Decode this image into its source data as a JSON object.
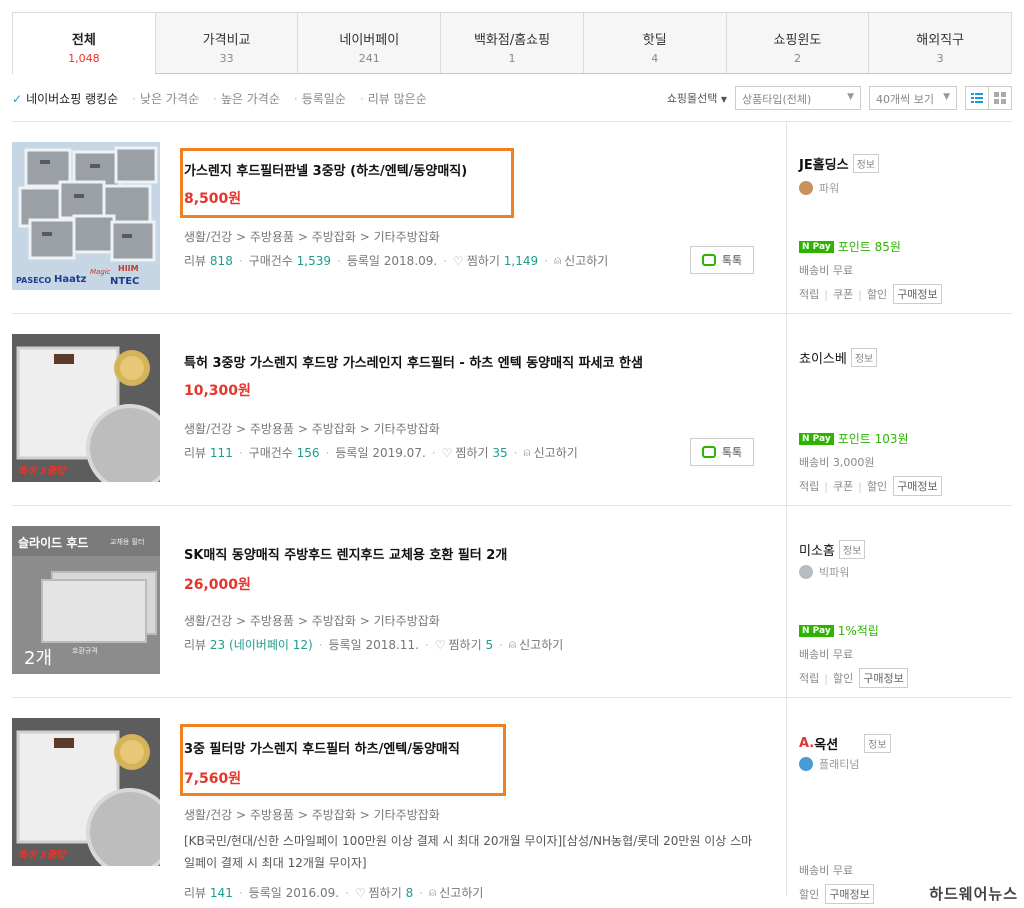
{
  "tabs": [
    {
      "label": "전체",
      "count": "1,048"
    },
    {
      "label": "가격비교",
      "count": "33"
    },
    {
      "label": "네이버페이",
      "count": "241"
    },
    {
      "label": "백화점/홈쇼핑",
      "count": "1"
    },
    {
      "label": "핫딜",
      "count": "4"
    },
    {
      "label": "쇼핑윈도",
      "count": "2"
    },
    {
      "label": "해외직구",
      "count": "3"
    }
  ],
  "sort": {
    "active": "네이버쇼핑 랭킹순",
    "options": [
      "낮은 가격순",
      "높은 가격순",
      "등록일순",
      "리뷰 많은순"
    ]
  },
  "toolbar": {
    "mall_select": "쇼핑몰선택",
    "product_type": "상품타입(전체)",
    "per_page": "40개씩 보기"
  },
  "items": [
    {
      "title": "가스렌지 후드필터판넬 3중망 (하츠/엔텍/동양매직)",
      "price": "8,500원",
      "category": "생활/건강 > 주방용품 > 주방잡화 > 기타주방잡화",
      "review_label": "리뷰",
      "review": "818",
      "purchase_label": "구매건수",
      "purchase": "1,539",
      "reg": "등록일 2018.09.",
      "zzim_label": "찜하기",
      "zzim": "1,149",
      "report": "신고하기",
      "talk": "톡톡",
      "thumb_brands": [
        "PASECO",
        "Haatz",
        "Magic",
        "HIIM",
        "NTEC"
      ],
      "seller": "JE홀딩스",
      "seller_badge": "정보",
      "grade": "파워",
      "npay": "포인트 85원",
      "ship": "배송비 무료",
      "tags": [
        "적립",
        "쿠폰",
        "할인"
      ],
      "purchase_info": "구매정보"
    },
    {
      "title": "특허 3중망 가스렌지 후드망 가스레인지 후드필터 - 하츠 엔텍 동양매직 파세코 한샘",
      "price": "10,300원",
      "category": "생활/건강 > 주방용품 > 주방잡화 > 기타주방잡화",
      "review_label": "리뷰",
      "review": "111",
      "purchase_label": "구매건수",
      "purchase": "156",
      "reg": "등록일 2019.07.",
      "zzim_label": "찜하기",
      "zzim": "35",
      "report": "신고하기",
      "talk": "톡톡",
      "thumb_label": "특허 3중망",
      "seller": "쵸이스베",
      "seller_badge": "정보",
      "npay": "포인트 103원",
      "ship": "배송비 3,000원",
      "tags": [
        "적립",
        "쿠폰",
        "할인"
      ],
      "purchase_info": "구매정보"
    },
    {
      "title": "SK매직 동양매직 주방후드 렌지후드 교체용 호환 필터 2개",
      "price": "26,000원",
      "category": "생활/건강 > 주방용품 > 주방잡화 > 기타주방잡화",
      "review_label": "리뷰",
      "review": "23",
      "npay_review": "(네이버페이 12)",
      "reg": "등록일 2018.11.",
      "zzim_label": "찜하기",
      "zzim": "5",
      "report": "신고하기",
      "thumb_title": "슬라이드 후드",
      "thumb_sub": "교체용 필터",
      "thumb_count": "2개",
      "thumb_note": "호환규격",
      "seller": "미소홈",
      "seller_badge": "정보",
      "grade": "빅파워",
      "npay": "1%적립",
      "ship": "배송비 무료",
      "tags": [
        "적립",
        "할인"
      ],
      "purchase_info": "구매정보"
    },
    {
      "title": "3중 필터망 가스렌지 후드필터 하츠/엔텍/동양매직",
      "price": "7,560원",
      "category": "생활/건강 > 주방용품 > 주방잡화 > 기타주방잡화",
      "desc": "[KB국민/현대/신한 스마일페이 100만원 이상 결제 시 최대 20개월 무이자][삼성/NH농협/롯데 20만원 이상 스마일페이 결제 시 최대 12개월 무이자]",
      "review_label": "리뷰",
      "review": "141",
      "reg": "등록일 2016.09.",
      "zzim_label": "찜하기",
      "zzim": "8",
      "report": "신고하기",
      "thumb_label": "특허 3중망",
      "seller_prefix": "A.",
      "seller": "옥션",
      "seller_badge": "정보",
      "grade": "플래티넘",
      "ship": "배송비 무료",
      "tags": [
        "할인"
      ],
      "purchase_info": "구매정보"
    }
  ],
  "watermark": "하드웨어뉴스",
  "colors": {
    "price": "#e4352b",
    "highlight": "#f08022",
    "npay": "#2db400",
    "count": "#1f9b8f"
  }
}
